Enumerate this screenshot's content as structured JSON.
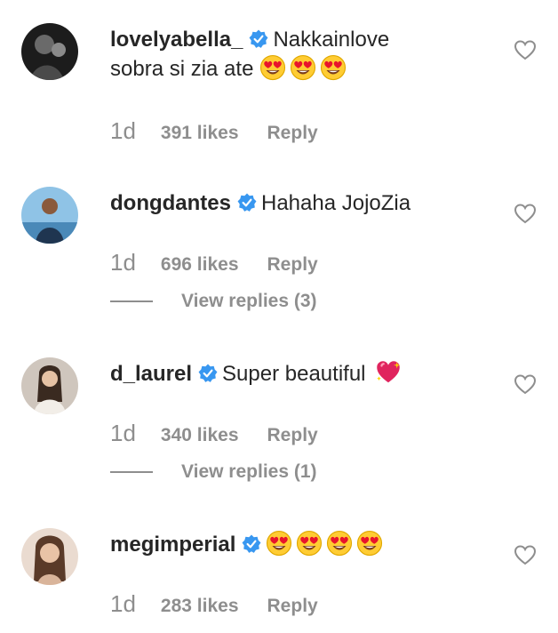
{
  "comments": [
    {
      "username": "lovelyabella_",
      "text": "Nakkainlove",
      "text_line2": "sobra si zia ate",
      "emojis": [
        "heart-eyes-emoji",
        "heart-eyes-emoji",
        "heart-eyes-emoji"
      ],
      "time": "1d",
      "likes": "391 likes",
      "reply": "Reply"
    },
    {
      "username": "dongdantes",
      "text": "Hahaha JojoZia",
      "time": "1d",
      "likes": "696 likes",
      "reply": "Reply",
      "view_replies": "View replies (3)"
    },
    {
      "username": "d_laurel",
      "text": "Super beautiful",
      "emojis": [
        "sparkling-heart-emoji"
      ],
      "time": "1d",
      "likes": "340 likes",
      "reply": "Reply",
      "view_replies": "View replies (1)"
    },
    {
      "username": "megimperial",
      "text": "",
      "emojis": [
        "heart-eyes-emoji",
        "heart-eyes-emoji",
        "heart-eyes-emoji",
        "heart-eyes-emoji"
      ],
      "time": "1d",
      "likes": "283 likes",
      "reply": "Reply"
    }
  ],
  "colors": {
    "text": "#262626",
    "meta": "#8e8e8e",
    "verified": "#3897f0"
  }
}
